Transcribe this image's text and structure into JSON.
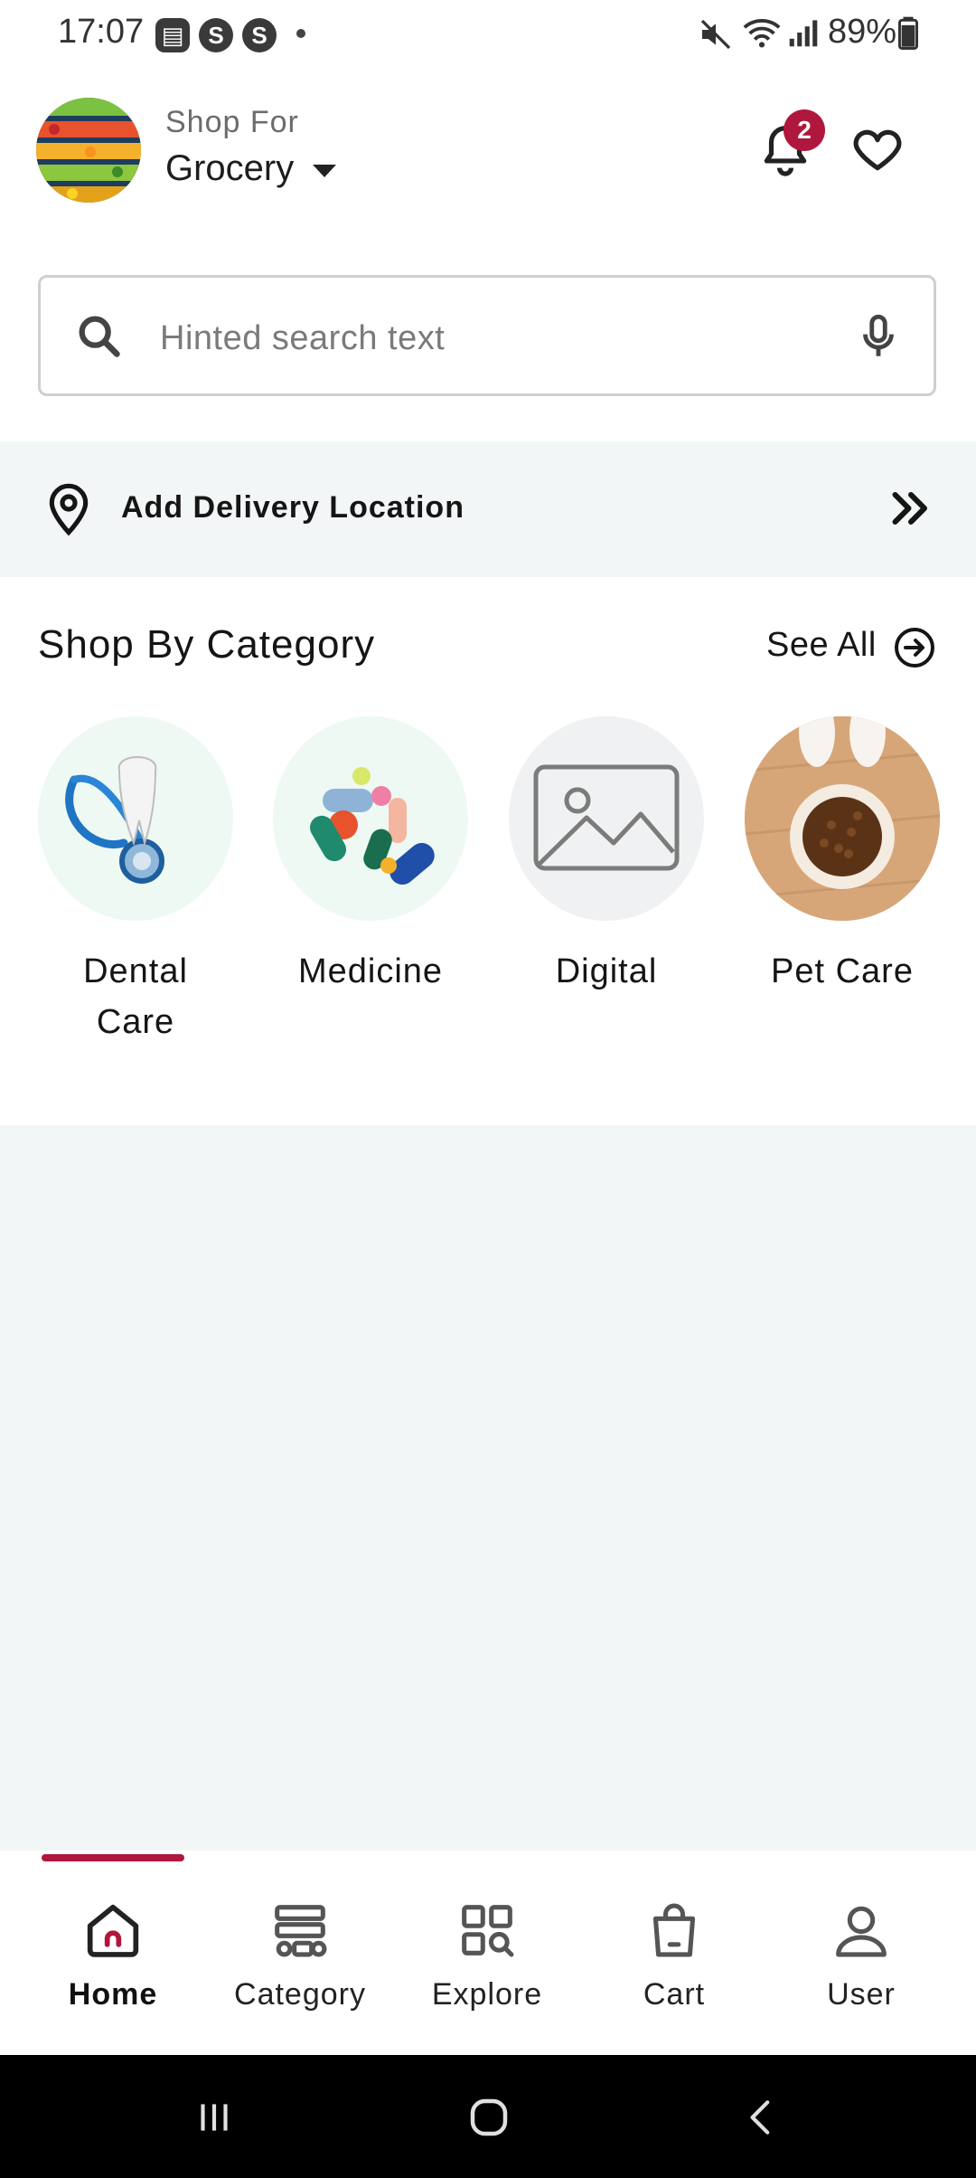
{
  "status_bar": {
    "time": "17:07",
    "app_icons": [
      "notes-icon",
      "s-icon",
      "s-icon"
    ],
    "battery": "89%"
  },
  "header": {
    "shop_for_label": "Shop For",
    "store_type": "Grocery",
    "notification_count": "2"
  },
  "search": {
    "placeholder": "Hinted search text"
  },
  "delivery": {
    "label": "Add Delivery Location"
  },
  "categories_section": {
    "title": "Shop By Category",
    "see_all": "See All",
    "items": [
      {
        "label_line1": "Dental",
        "label_line2": "Care",
        "icon": "tooth-stethoscope-image"
      },
      {
        "label_line1": "Medicine",
        "label_line2": "",
        "icon": "pills-image"
      },
      {
        "label_line1": "Digital",
        "label_line2": "",
        "icon": "image-placeholder-icon"
      },
      {
        "label_line1": "Pet Care",
        "label_line2": "",
        "icon": "pet-food-bowl-image"
      }
    ]
  },
  "bottom_nav": {
    "active": "Home",
    "items": [
      {
        "label": "Home",
        "icon": "home-icon"
      },
      {
        "label": "Category",
        "icon": "category-icon"
      },
      {
        "label": "Explore",
        "icon": "explore-icon"
      },
      {
        "label": "Cart",
        "icon": "cart-icon"
      },
      {
        "label": "User",
        "icon": "user-icon"
      }
    ]
  },
  "colors": {
    "accent": "#b0173c",
    "panel_bg": "#f3f6f7"
  }
}
